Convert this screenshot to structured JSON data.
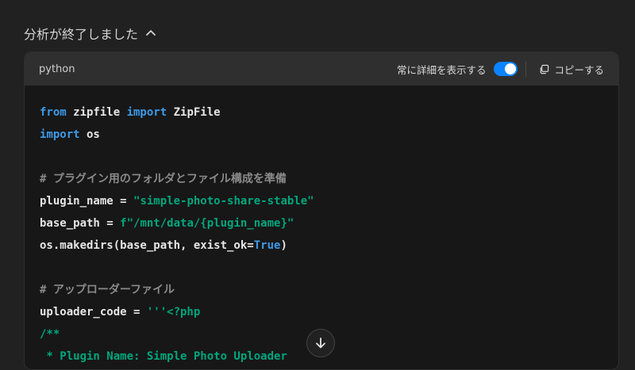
{
  "status": {
    "label": "分析が終了しました"
  },
  "card": {
    "language": "python",
    "toggle_label": "常に詳細を表示する",
    "copy_label": "コピーする"
  },
  "code": {
    "l1_a": "from",
    "l1_b": " zipfile ",
    "l1_c": "import",
    "l1_d": " ZipFile",
    "l2_a": "import",
    "l2_b": " os",
    "l4": "# プラグイン用のフォルダとファイル構成を準備",
    "l5_a": "plugin_name = ",
    "l5_b": "\"simple-photo-share-stable\"",
    "l6_a": "base_path = ",
    "l6_b": "f\"/mnt/data/{plugin_name}\"",
    "l7_a": "os.makedirs(base_path, exist_ok=",
    "l7_b": "True",
    "l7_c": ")",
    "l9": "# アップローダーファイル",
    "l10_a": "uploader_code = ",
    "l10_b": "'''<?php",
    "l11": "/**",
    "l12": " * Plugin Name: Simple Photo Uploader"
  },
  "colors": {
    "keyword": "#3d9be9",
    "string": "#00a67d",
    "comment": "#8a8a8a",
    "toggle_on": "#0b84ff"
  }
}
